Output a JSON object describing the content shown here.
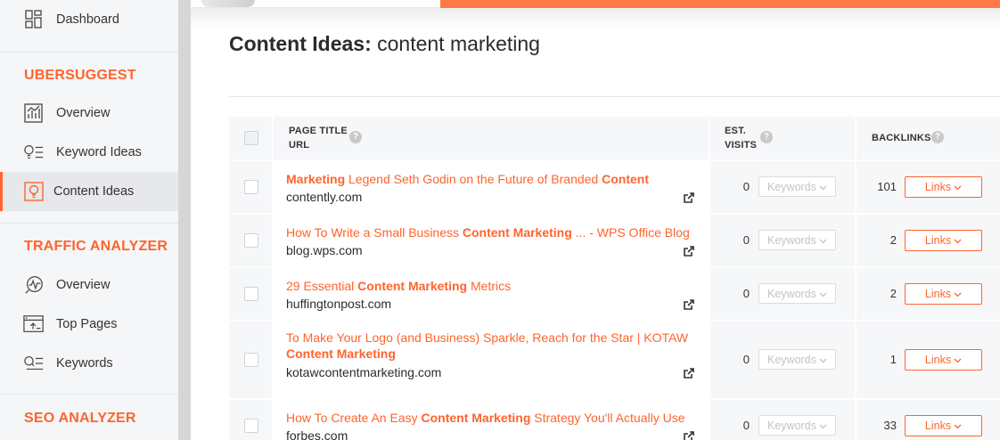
{
  "sidebar": {
    "dashboard": {
      "label": "Dashboard",
      "icon": "dashboard-icon"
    },
    "sections": [
      {
        "title": "UBERSUGGEST",
        "items": [
          {
            "label": "Overview",
            "icon": "chart-bars-icon"
          },
          {
            "label": "Keyword Ideas",
            "icon": "bulb-list-icon"
          },
          {
            "label": "Content Ideas",
            "icon": "content-bulb-icon",
            "active": true
          }
        ]
      },
      {
        "title": "TRAFFIC ANALYZER",
        "items": [
          {
            "label": "Overview",
            "icon": "pulse-icon"
          },
          {
            "label": "Top Pages",
            "icon": "top-pages-icon"
          },
          {
            "label": "Keywords",
            "icon": "search-list-icon"
          }
        ]
      },
      {
        "title": "SEO ANALYZER",
        "items": []
      }
    ]
  },
  "page": {
    "title_prefix": "Content Ideas:",
    "title_query": "content marketing"
  },
  "table": {
    "headers": {
      "page_title": "PAGE TITLE",
      "url": "URL",
      "est": "EST.",
      "visits": "VISITS",
      "backlinks": "BACKLINKS",
      "help": "?"
    },
    "keywords_label": "Keywords",
    "links_label": "Links",
    "rows": [
      {
        "title_parts": [
          {
            "text": "Marketing",
            "bold": true
          },
          {
            "text": " Legend Seth Godin on the Future of Branded ",
            "bold": false
          },
          {
            "text": "Content",
            "bold": true
          }
        ],
        "title_parts_line2": [],
        "url": "contently.com",
        "visits": "0",
        "backlinks": "101"
      },
      {
        "title_parts": [
          {
            "text": "How To Write a Small Business ",
            "bold": false
          },
          {
            "text": "Content Marketing",
            "bold": true
          },
          {
            "text": " ... - WPS Office Blog",
            "bold": false
          }
        ],
        "title_parts_line2": [],
        "url": "blog.wps.com",
        "visits": "0",
        "backlinks": "2"
      },
      {
        "title_parts": [
          {
            "text": "29 Essential ",
            "bold": false
          },
          {
            "text": "Content Marketing",
            "bold": true
          },
          {
            "text": " Metrics",
            "bold": false
          }
        ],
        "title_parts_line2": [],
        "url": "huffingtonpost.com",
        "visits": "0",
        "backlinks": "2"
      },
      {
        "title_parts": [
          {
            "text": "To Make Your Logo (and Business) Sparkle, Reach for the Star | KOTAW",
            "bold": false
          }
        ],
        "title_parts_line2": [
          {
            "text": "Content Marketing",
            "bold": true
          }
        ],
        "url": "kotawcontentmarketing.com",
        "visits": "0",
        "backlinks": "1"
      },
      {
        "title_parts": [
          {
            "text": "How To Create An Easy ",
            "bold": false
          },
          {
            "text": "Content Marketing",
            "bold": true
          },
          {
            "text": " Strategy You'll Actually Use",
            "bold": false
          }
        ],
        "title_parts_line2": [],
        "url": "forbes.com",
        "visits": "0",
        "backlinks": "33"
      }
    ]
  },
  "colors": {
    "accent": "#ff642d",
    "sidebar_bg": "#f5f6f8",
    "active_bg": "#e6e8ec"
  }
}
